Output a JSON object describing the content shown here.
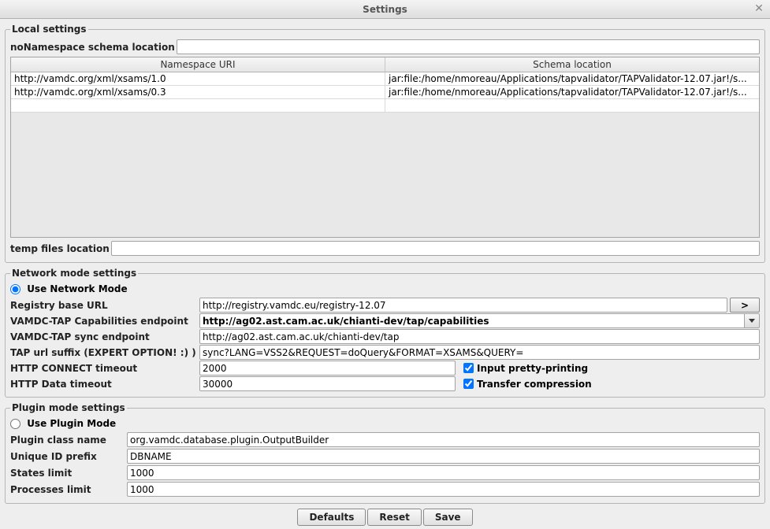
{
  "window": {
    "title": "Settings"
  },
  "local": {
    "legend": "Local settings",
    "nons_label": "noNamespace schema location",
    "nons_value": "",
    "table": {
      "headers": [
        "Namespace URI",
        "Schema location"
      ],
      "rows": [
        {
          "ns": "http://vamdc.org/xml/xsams/1.0",
          "loc": "jar:file:/home/nmoreau/Applications/tapvalidator/TAPValidator-12.07.jar!/s..."
        },
        {
          "ns": "http://vamdc.org/xml/xsams/0.3",
          "loc": "jar:file:/home/nmoreau/Applications/tapvalidator/TAPValidator-12.07.jar!/s..."
        }
      ]
    },
    "temp_label": "temp files location",
    "temp_value": ""
  },
  "network": {
    "legend": "Network mode settings",
    "mode_label": "Use Network Mode",
    "mode_checked": true,
    "registry_label": "Registry base URL",
    "registry_value": "http://registry.vamdc.eu/registry-12.07",
    "go_label": ">",
    "cap_label": "VAMDC-TAP Capabilities endpoint",
    "cap_value": "http://ag02.ast.cam.ac.uk/chianti-dev/tap/capabilities",
    "sync_label": "VAMDC-TAP sync endpoint",
    "sync_value": "http://ag02.ast.cam.ac.uk/chianti-dev/tap",
    "suffix_label": "TAP url suffix (EXPERT OPTION! :) )",
    "suffix_value": "sync?LANG=VSS2&REQUEST=doQuery&FORMAT=XSAMS&QUERY=",
    "connect_label": "HTTP CONNECT timeout",
    "connect_value": "2000",
    "data_label": "HTTP Data timeout",
    "data_value": "30000",
    "pretty_label": "Input pretty-printing",
    "pretty_checked": true,
    "compress_label": "Transfer compression",
    "compress_checked": true
  },
  "plugin": {
    "legend": "Plugin mode settings",
    "mode_label": "Use Plugin Mode",
    "mode_checked": false,
    "class_label": "Plugin class name",
    "class_value": "org.vamdc.database.plugin.OutputBuilder",
    "prefix_label": "Unique ID prefix",
    "prefix_value": "DBNAME",
    "states_label": "States limit",
    "states_value": "1000",
    "proc_label": "Processes limit",
    "proc_value": "1000"
  },
  "buttons": {
    "defaults": "Defaults",
    "reset": "Reset",
    "save": "Save"
  }
}
